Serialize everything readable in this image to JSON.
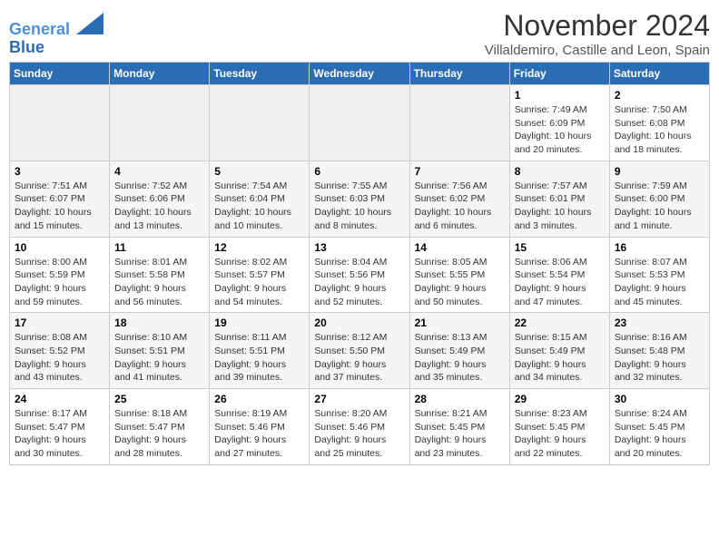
{
  "header": {
    "logo_line1": "General",
    "logo_line2": "Blue",
    "month": "November 2024",
    "location": "Villaldemiro, Castille and Leon, Spain"
  },
  "days_of_week": [
    "Sunday",
    "Monday",
    "Tuesday",
    "Wednesday",
    "Thursday",
    "Friday",
    "Saturday"
  ],
  "weeks": [
    [
      {
        "day": "",
        "content": ""
      },
      {
        "day": "",
        "content": ""
      },
      {
        "day": "",
        "content": ""
      },
      {
        "day": "",
        "content": ""
      },
      {
        "day": "",
        "content": ""
      },
      {
        "day": "1",
        "content": "Sunrise: 7:49 AM\nSunset: 6:09 PM\nDaylight: 10 hours and 20 minutes."
      },
      {
        "day": "2",
        "content": "Sunrise: 7:50 AM\nSunset: 6:08 PM\nDaylight: 10 hours and 18 minutes."
      }
    ],
    [
      {
        "day": "3",
        "content": "Sunrise: 7:51 AM\nSunset: 6:07 PM\nDaylight: 10 hours and 15 minutes."
      },
      {
        "day": "4",
        "content": "Sunrise: 7:52 AM\nSunset: 6:06 PM\nDaylight: 10 hours and 13 minutes."
      },
      {
        "day": "5",
        "content": "Sunrise: 7:54 AM\nSunset: 6:04 PM\nDaylight: 10 hours and 10 minutes."
      },
      {
        "day": "6",
        "content": "Sunrise: 7:55 AM\nSunset: 6:03 PM\nDaylight: 10 hours and 8 minutes."
      },
      {
        "day": "7",
        "content": "Sunrise: 7:56 AM\nSunset: 6:02 PM\nDaylight: 10 hours and 6 minutes."
      },
      {
        "day": "8",
        "content": "Sunrise: 7:57 AM\nSunset: 6:01 PM\nDaylight: 10 hours and 3 minutes."
      },
      {
        "day": "9",
        "content": "Sunrise: 7:59 AM\nSunset: 6:00 PM\nDaylight: 10 hours and 1 minute."
      }
    ],
    [
      {
        "day": "10",
        "content": "Sunrise: 8:00 AM\nSunset: 5:59 PM\nDaylight: 9 hours and 59 minutes."
      },
      {
        "day": "11",
        "content": "Sunrise: 8:01 AM\nSunset: 5:58 PM\nDaylight: 9 hours and 56 minutes."
      },
      {
        "day": "12",
        "content": "Sunrise: 8:02 AM\nSunset: 5:57 PM\nDaylight: 9 hours and 54 minutes."
      },
      {
        "day": "13",
        "content": "Sunrise: 8:04 AM\nSunset: 5:56 PM\nDaylight: 9 hours and 52 minutes."
      },
      {
        "day": "14",
        "content": "Sunrise: 8:05 AM\nSunset: 5:55 PM\nDaylight: 9 hours and 50 minutes."
      },
      {
        "day": "15",
        "content": "Sunrise: 8:06 AM\nSunset: 5:54 PM\nDaylight: 9 hours and 47 minutes."
      },
      {
        "day": "16",
        "content": "Sunrise: 8:07 AM\nSunset: 5:53 PM\nDaylight: 9 hours and 45 minutes."
      }
    ],
    [
      {
        "day": "17",
        "content": "Sunrise: 8:08 AM\nSunset: 5:52 PM\nDaylight: 9 hours and 43 minutes."
      },
      {
        "day": "18",
        "content": "Sunrise: 8:10 AM\nSunset: 5:51 PM\nDaylight: 9 hours and 41 minutes."
      },
      {
        "day": "19",
        "content": "Sunrise: 8:11 AM\nSunset: 5:51 PM\nDaylight: 9 hours and 39 minutes."
      },
      {
        "day": "20",
        "content": "Sunrise: 8:12 AM\nSunset: 5:50 PM\nDaylight: 9 hours and 37 minutes."
      },
      {
        "day": "21",
        "content": "Sunrise: 8:13 AM\nSunset: 5:49 PM\nDaylight: 9 hours and 35 minutes."
      },
      {
        "day": "22",
        "content": "Sunrise: 8:15 AM\nSunset: 5:49 PM\nDaylight: 9 hours and 34 minutes."
      },
      {
        "day": "23",
        "content": "Sunrise: 8:16 AM\nSunset: 5:48 PM\nDaylight: 9 hours and 32 minutes."
      }
    ],
    [
      {
        "day": "24",
        "content": "Sunrise: 8:17 AM\nSunset: 5:47 PM\nDaylight: 9 hours and 30 minutes."
      },
      {
        "day": "25",
        "content": "Sunrise: 8:18 AM\nSunset: 5:47 PM\nDaylight: 9 hours and 28 minutes."
      },
      {
        "day": "26",
        "content": "Sunrise: 8:19 AM\nSunset: 5:46 PM\nDaylight: 9 hours and 27 minutes."
      },
      {
        "day": "27",
        "content": "Sunrise: 8:20 AM\nSunset: 5:46 PM\nDaylight: 9 hours and 25 minutes."
      },
      {
        "day": "28",
        "content": "Sunrise: 8:21 AM\nSunset: 5:45 PM\nDaylight: 9 hours and 23 minutes."
      },
      {
        "day": "29",
        "content": "Sunrise: 8:23 AM\nSunset: 5:45 PM\nDaylight: 9 hours and 22 minutes."
      },
      {
        "day": "30",
        "content": "Sunrise: 8:24 AM\nSunset: 5:45 PM\nDaylight: 9 hours and 20 minutes."
      }
    ]
  ]
}
